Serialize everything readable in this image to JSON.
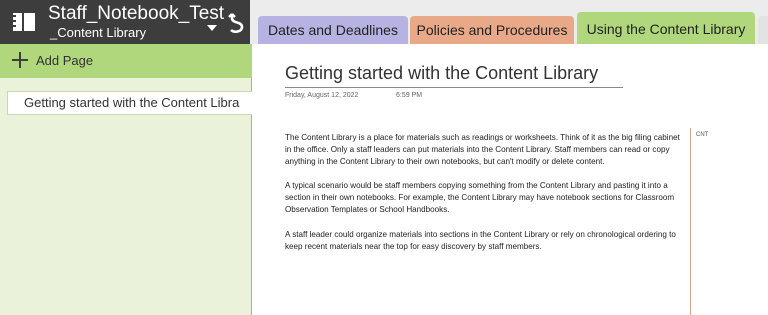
{
  "notebook": {
    "name": "Staff_Notebook_Test",
    "current_section": "_Content Library",
    "back_glyph": "↻"
  },
  "tabs": [
    {
      "label": "Dates and Deadlines",
      "color": "#b6b2e2"
    },
    {
      "label": "Policies and Procedures",
      "color": "#e9a988"
    },
    {
      "label": "Using the Content Library",
      "color": "#b0d77c",
      "active": true
    }
  ],
  "pages_pane": {
    "add_page_label": "Add Page",
    "items": [
      "Getting started with the Content Libra"
    ]
  },
  "page": {
    "title": "Getting started with the Content Library",
    "date": "Friday, August 12, 2022",
    "time": "6:59 PM",
    "paragraphs": [
      "The Content Library is a place for materials such as readings or worksheets.  Think of it as the big filing cabinet in the office. Only a staff leaders can put materials into the Content Library. Staff members can read or copy anything in the Content Library to their own notebooks, but can't modify or delete content.",
      "A typical scenario would be staff members copying something from the Content Library and pasting it into a section in their own notebooks. For example, the Content Library may have notebook sections for Classroom Observation Templates or School Handbooks.",
      "A staff leader could organize materials into sections in the Content Library or rely on chronological ordering to keep recent materials near the top for easy discovery by staff members."
    ],
    "side_note": "CNT"
  },
  "colors": {
    "section_green": "#b0d77c",
    "header_dark": "#3d3d3d"
  }
}
